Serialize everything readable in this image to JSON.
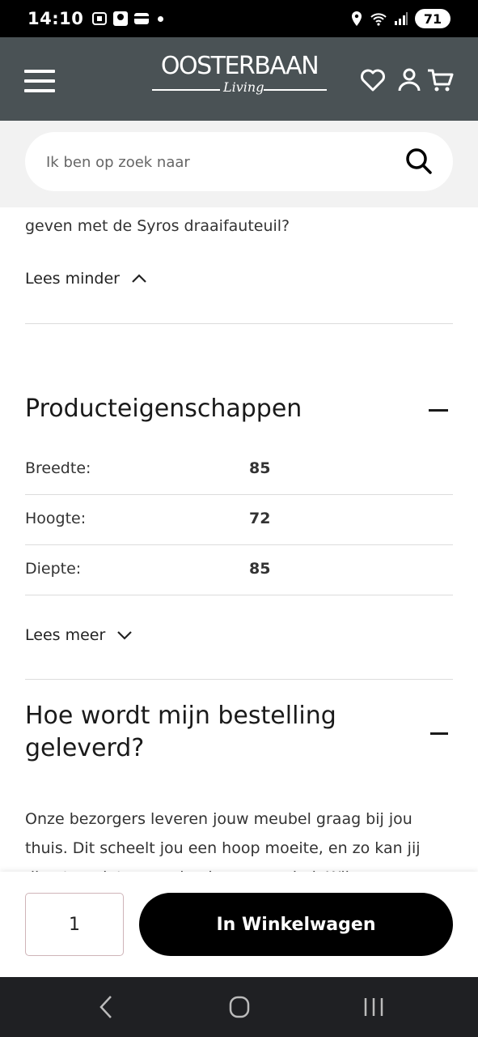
{
  "status_bar": {
    "time": "14:10",
    "battery": "71"
  },
  "header": {
    "logo_text": "OOSTERBAAN",
    "logo_sub": "Living",
    "icons": [
      "menu-icon",
      "heart-icon",
      "user-icon",
      "cart-icon"
    ]
  },
  "search": {
    "placeholder": "Ik ben op zoek naar"
  },
  "description": {
    "text_tail": "geven met de Syros draaifauteuil?",
    "toggle_label": "Lees minder"
  },
  "properties": {
    "title": "Producteigenschappen",
    "rows": [
      {
        "label": "Breedte:",
        "value": "85"
      },
      {
        "label": "Hoogte:",
        "value": "72"
      },
      {
        "label": "Diepte:",
        "value": "85"
      }
    ],
    "toggle_label": "Lees meer"
  },
  "delivery": {
    "title": "Hoe wordt mijn bestelling geleverd?",
    "text": "Onze bezorgers leveren jouw meubel graag bij jou thuis. Dit scheelt jou een hoop moeite, en zo kan jij direct genieten van je nieuwe meubel. Wij"
  },
  "cart": {
    "quantity": "1",
    "button_label": "In Winkelwagen"
  },
  "colors": {
    "header_bg": "#4a5255",
    "search_bg": "#f2f2f2",
    "button_bg": "#000000",
    "navbar_bg": "#1f2023"
  }
}
